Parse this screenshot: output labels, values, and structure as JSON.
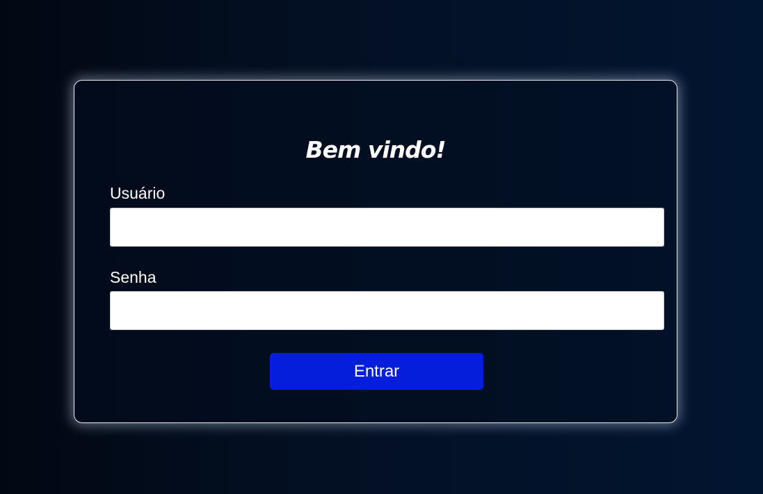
{
  "login": {
    "title": "Bem vindo!",
    "username_label": "Usuário",
    "username_value": "",
    "password_label": "Senha",
    "password_value": "",
    "submit_label": "Entrar"
  },
  "colors": {
    "background": "#031024",
    "card_border": "#e7ecf5",
    "button": "#041edb",
    "text": "#ffffff"
  }
}
